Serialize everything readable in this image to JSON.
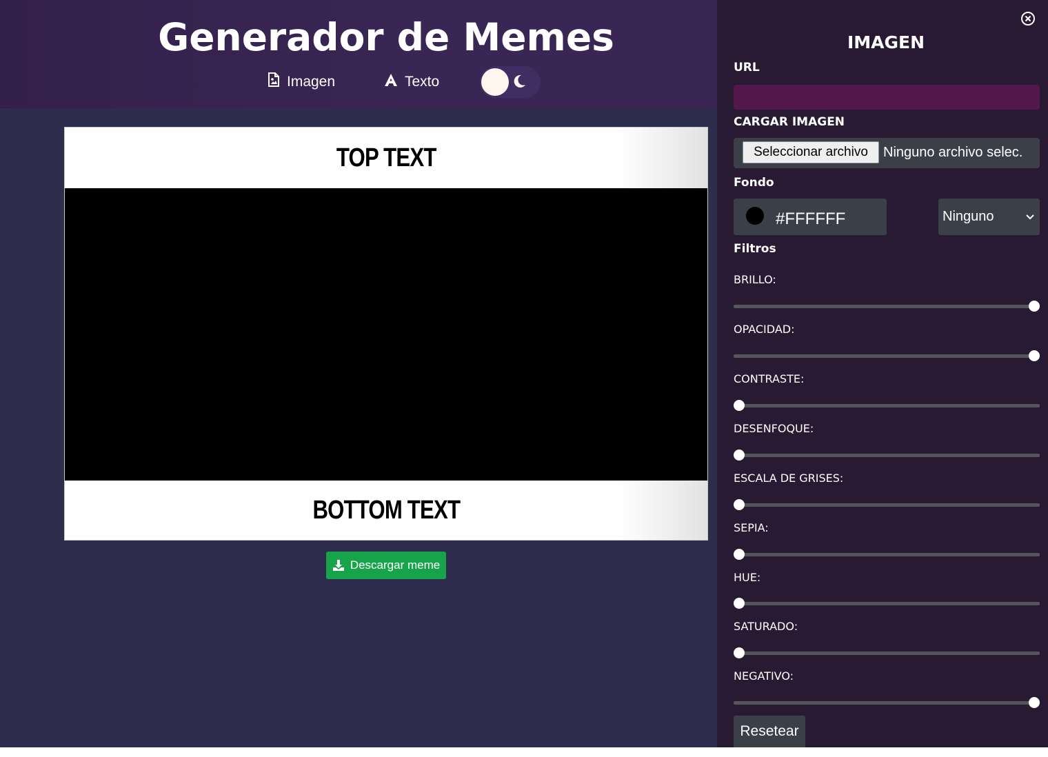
{
  "header": {
    "title": "Generador de Memes",
    "nav": [
      {
        "label": "Imagen",
        "icon": "file-image-icon"
      },
      {
        "label": "Texto",
        "icon": "font-icon"
      }
    ],
    "theme_toggle": {
      "icon": "moon-icon",
      "state": "dark"
    }
  },
  "meme": {
    "top_text": "TOP TEXT",
    "bottom_text": "BOTTOM TEXT",
    "image_background": "#000000"
  },
  "download_button": {
    "label": "Descargar meme",
    "icon": "download-icon",
    "color": "#17a34a"
  },
  "panel": {
    "close_icon": "close-circle-icon",
    "title": "IMAGEN",
    "url_label": "URL",
    "url_value": "",
    "upload_label": "CARGAR IMAGEN",
    "file_button": "Seleccionar archivo",
    "file_status": "Ninguno archivo selec.",
    "background_label": "Fondo",
    "background_color": "#FFFFFF",
    "blend_mode": "Ninguno",
    "filters_label": "Filtros",
    "filters": [
      {
        "label": "BRILLO:",
        "value": 1.0
      },
      {
        "label": "OPACIDAD:",
        "value": 1.0
      },
      {
        "label": "CONTRASTE:",
        "value": 0.0
      },
      {
        "label": "DESENFOQUE:",
        "value": 0.0
      },
      {
        "label": "ESCALA DE GRISES:",
        "value": 0.0
      },
      {
        "label": "SEPIA:",
        "value": 0.0
      },
      {
        "label": "HUE:",
        "value": 0.0
      },
      {
        "label": "SATURADO:",
        "value": 0.0
      },
      {
        "label": "NEGATIVO:",
        "value": 1.0
      }
    ],
    "reset_button": "Resetear"
  },
  "colors": {
    "header_bg": "#3a2654",
    "body_bg": "#2f2d4d",
    "panel_bg": "#291a33",
    "url_input_bg": "#54174c",
    "control_bg": "#3b3f48"
  }
}
